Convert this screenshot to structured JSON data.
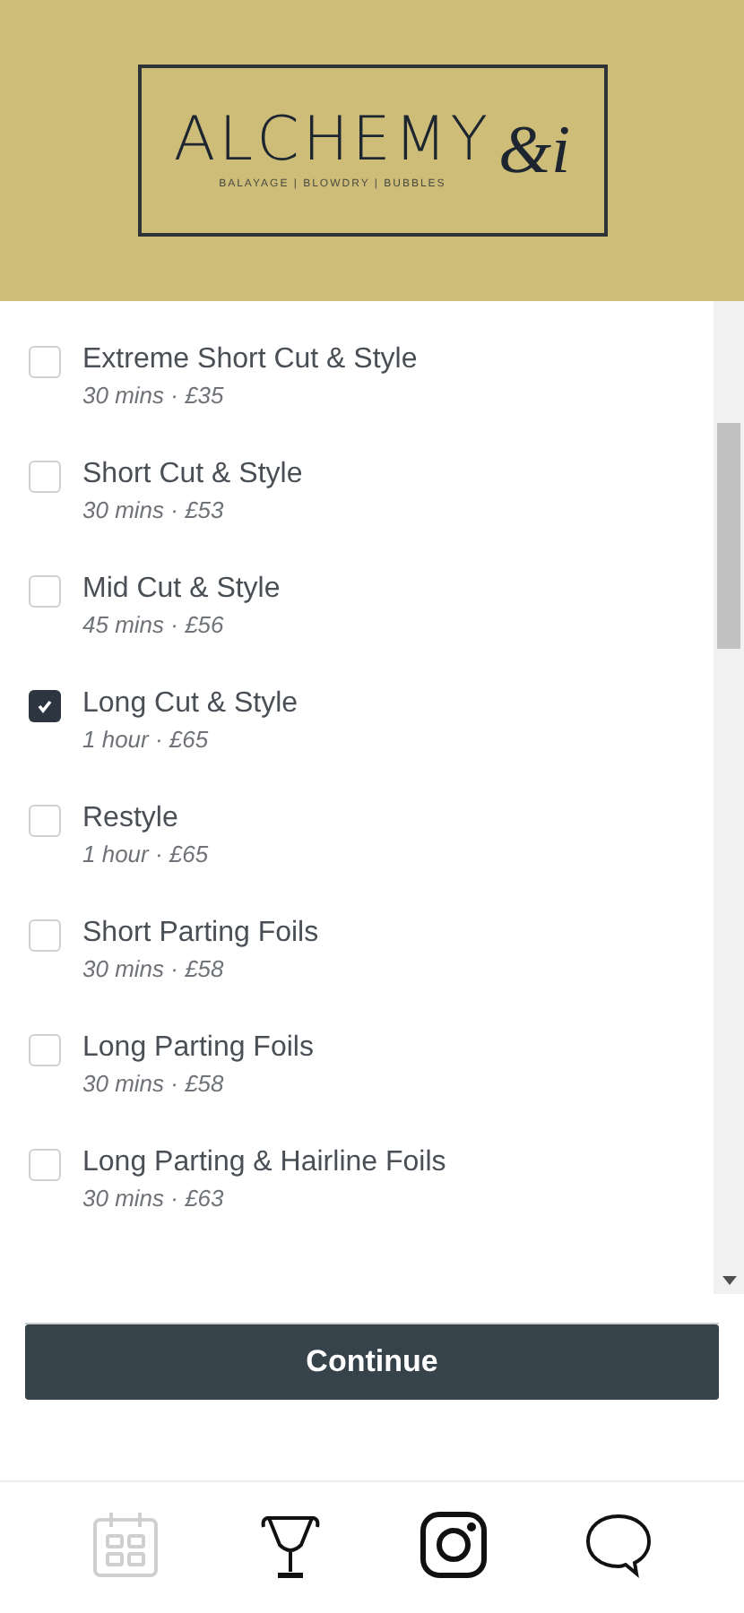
{
  "logo": {
    "name": "ALCHEMY",
    "mark": "&i",
    "tagline": "BALAYAGE | BLOWDRY | BUBBLES"
  },
  "services": [
    {
      "name": "Extreme Short Cut & Style",
      "details": "30 mins · £35",
      "checked": false
    },
    {
      "name": "Short Cut & Style",
      "details": "30 mins · £53",
      "checked": false
    },
    {
      "name": "Mid Cut & Style",
      "details": "45 mins · £56",
      "checked": false
    },
    {
      "name": "Long Cut & Style",
      "details": "1 hour · £65",
      "checked": true
    },
    {
      "name": "Restyle",
      "details": "1 hour · £65",
      "checked": false
    },
    {
      "name": "Short Parting Foils",
      "details": "30 mins · £58",
      "checked": false
    },
    {
      "name": "Long Parting Foils",
      "details": "30 mins · £58",
      "checked": false
    },
    {
      "name": "Long Parting & Hairline Foils",
      "details": "30 mins · £63",
      "checked": false
    }
  ],
  "continue_button": "Continue",
  "bottom_nav": [
    {
      "kind": "calendar",
      "selected": true
    },
    {
      "kind": "trophy",
      "selected": false
    },
    {
      "kind": "camera",
      "selected": false
    },
    {
      "kind": "chat",
      "selected": false
    }
  ]
}
